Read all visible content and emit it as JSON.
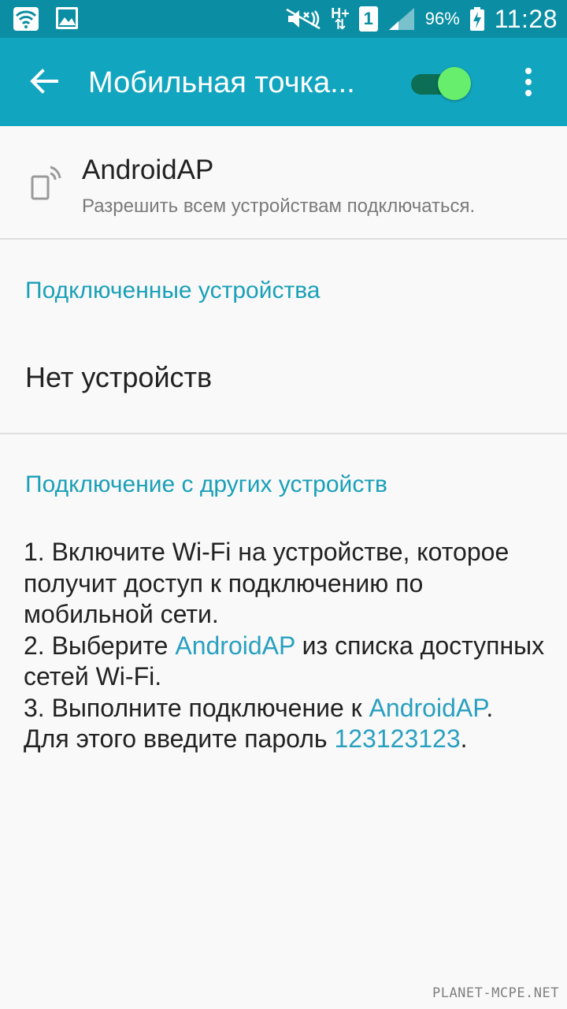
{
  "status_bar": {
    "battery_percent": "96%",
    "time": "11:28",
    "sim_slot": "1",
    "network_type": "H+",
    "icons": [
      "wifi-icon",
      "image-notification-icon",
      "mute-icon",
      "data-activity-icon",
      "sim-icon",
      "signal-icon",
      "battery-charging-icon"
    ]
  },
  "app_bar": {
    "title": "Мобильная точка...",
    "toggle_on": true,
    "colors": {
      "bar": "#12a5bf",
      "status": "#0b8ea3",
      "thumb": "#66ee6c"
    }
  },
  "access_point": {
    "name": "AndroidAP",
    "subtitle": "Разрешить всем устройствам подключаться."
  },
  "connected_section": {
    "header": "Подключенные устройства",
    "empty_text": "Нет устройств"
  },
  "connect_section": {
    "header": "Подключение с других устройств",
    "step1": "1. Включите Wi-Fi на устройстве, которое получит доступ к подключению по мобильной сети.",
    "step2_prefix": "2. Выберите ",
    "step2_link": "AndroidAP",
    "step2_suffix": " из списка доступных сетей Wi-Fi.",
    "step3_prefix": "3. Выполните подключение к ",
    "step3_link": "AndroidAP",
    "step3_suffix": ".",
    "step4_prefix": "Для этого введите пароль ",
    "password": "123123123",
    "step4_suffix": "."
  },
  "watermark": "PLANET-MCPE.NET"
}
